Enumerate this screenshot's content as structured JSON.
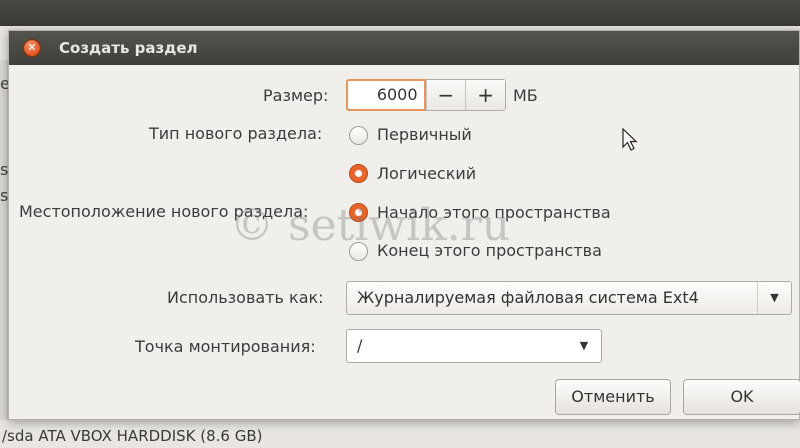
{
  "background": {
    "left_fragments": [
      "e",
      "s",
      "s"
    ],
    "disk_label": "/sda  ATA VBOX HARDDISK (8.6 GB)"
  },
  "dialog": {
    "title": "Создать раздел",
    "size": {
      "label": "Размер:",
      "value": "6000",
      "minus": "−",
      "plus": "+",
      "unit": "МБ"
    },
    "partition_type": {
      "label": "Тип нового раздела:",
      "options": [
        {
          "label": "Первичный",
          "selected": false
        },
        {
          "label": "Логический",
          "selected": true
        }
      ]
    },
    "location": {
      "label": "Местоположение нового раздела:",
      "options": [
        {
          "label": "Начало этого пространства",
          "selected": true
        },
        {
          "label": "Конец этого пространства",
          "selected": false
        }
      ]
    },
    "use_as": {
      "label": "Использовать как:",
      "value": "Журналируемая файловая система Ext4"
    },
    "mount_point": {
      "label": "Точка монтирования:",
      "value": "/"
    },
    "buttons": {
      "cancel": "Отменить",
      "ok": "OK"
    }
  },
  "watermark": "© setiwik.ru",
  "colors": {
    "accent": "#e8642a",
    "titlebar": "#4a4944",
    "dialog_bg": "#f1efec"
  }
}
